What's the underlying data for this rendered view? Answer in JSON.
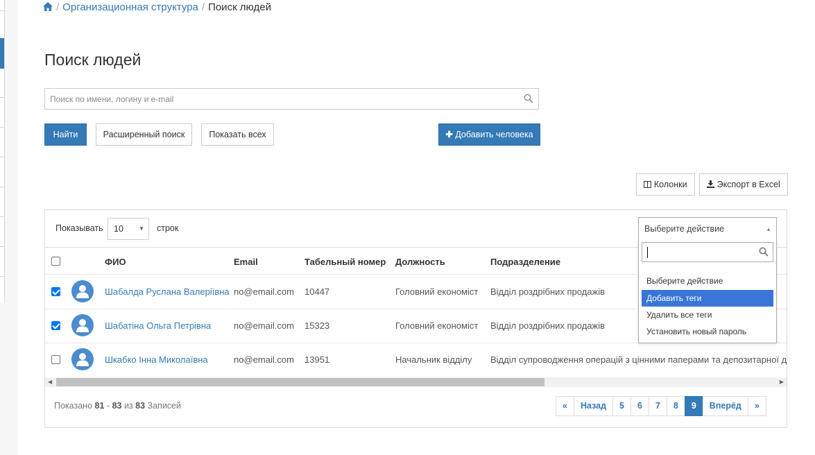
{
  "breadcrumb": {
    "home_icon": "home-icon",
    "items": [
      "Организационная структура",
      "Поиск людей"
    ]
  },
  "page": {
    "title": "Поиск людей"
  },
  "search": {
    "placeholder": "Поиск по имени, логину и e-mail",
    "icon": "search-icon",
    "find_label": "Найти",
    "advanced_label": "Расширенный поиск",
    "show_all_label": "Показать всех",
    "add_person_label": "Добавить человека"
  },
  "toolbar": {
    "columns_label": "Колонки",
    "export_label": "Экспорт в Excel"
  },
  "table_controls": {
    "show_label": "Показывать",
    "rows_value": "10",
    "rows_label": "строк",
    "action_value": "Выберите действие"
  },
  "action_dropdown": {
    "search_value": "",
    "options": [
      "Выберите действие",
      "Добавить теги",
      "Удалить все теги",
      "Установить новый пароль"
    ],
    "highlighted": "Добавить теги"
  },
  "table": {
    "headers": [
      "ФИО",
      "Email",
      "Табельный номер",
      "Должность",
      "Подразделение"
    ],
    "rows": [
      {
        "checked": true,
        "name": "Шабалда Руслана Валеріївна",
        "email": "no@email.com",
        "number": "10447",
        "position": "Головний економіст",
        "department": "Відділ роздрібних продажів"
      },
      {
        "checked": true,
        "name": "Шабатіна Ольга Петрівна",
        "email": "no@email.com",
        "number": "15323",
        "position": "Головний економіст",
        "department": "Відділ роздрібних продажів"
      },
      {
        "checked": false,
        "name": "Шкабко Інна Миколаївна",
        "email": "no@email.com",
        "number": "13951",
        "position": "Начальник відділу",
        "department": "Відділ супроводження операцій з цінними паперами та депозитарної д"
      }
    ]
  },
  "summary": {
    "prefix": "Показано",
    "from": "81",
    "dash": "-",
    "to": "83",
    "of": "из",
    "total": "83",
    "suffix": "Записей"
  },
  "pagination": {
    "first": "«",
    "prev": "Назад",
    "pages": [
      "5",
      "6",
      "7",
      "8",
      "9"
    ],
    "current": "9",
    "next": "Вперёд",
    "last": "»"
  },
  "colors": {
    "accent": "#337ab7",
    "highlight": "#3875d7",
    "checkbox": "#0075ff"
  }
}
